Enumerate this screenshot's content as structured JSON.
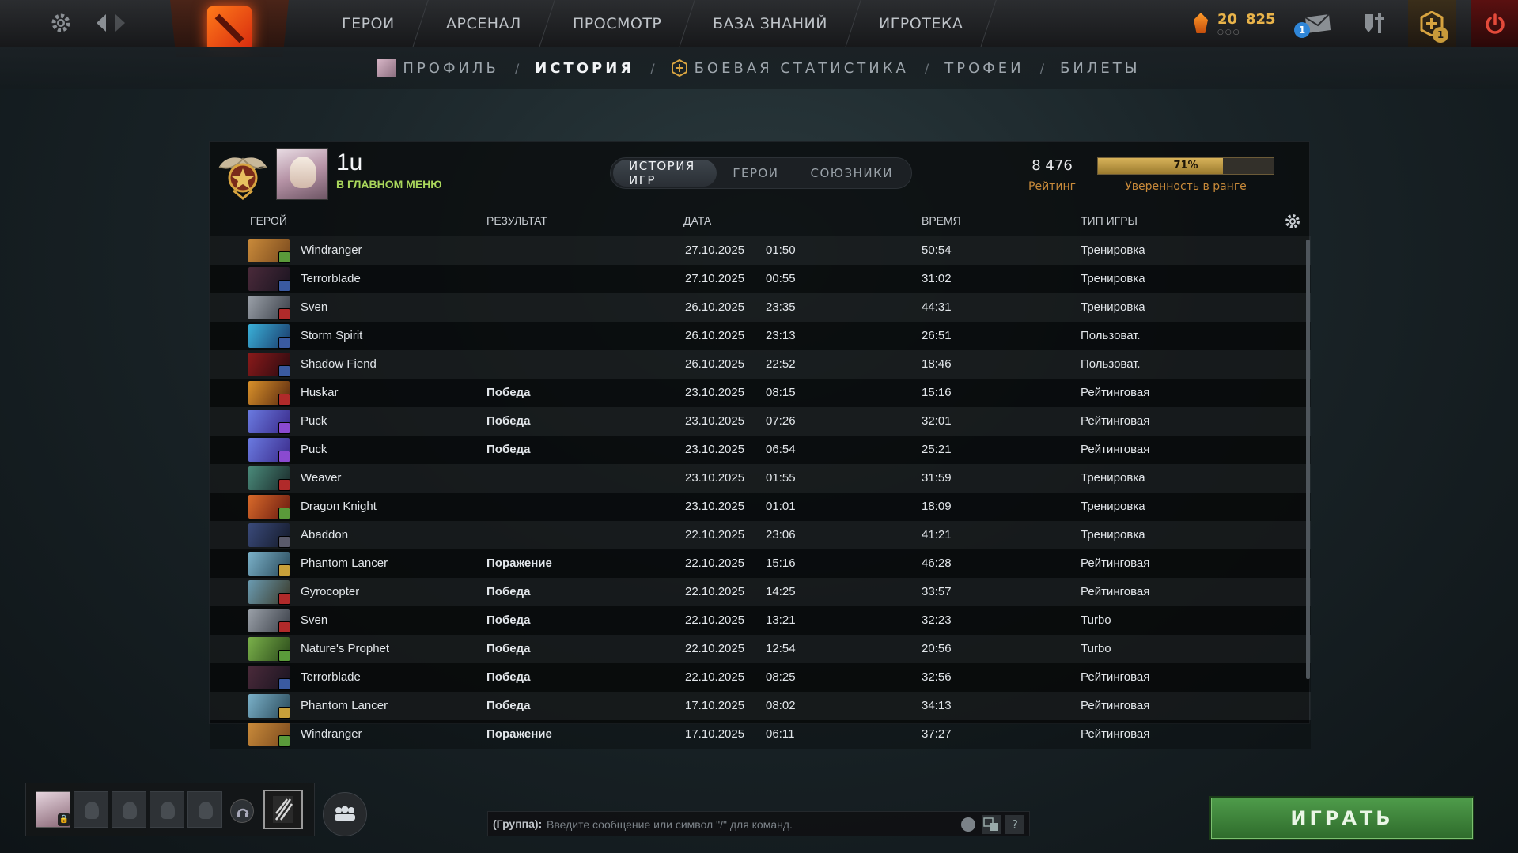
{
  "topbar": {
    "nav": [
      "ГЕРОИ",
      "АРСЕНАЛ",
      "ПРОСМОТР",
      "БАЗА ЗНАНИЙ",
      "ИГРОТЕКА"
    ],
    "currency_main": "20",
    "currency_secondary": "825",
    "mail_badge": "1",
    "shop_badge": "1"
  },
  "subnav": {
    "profile": "ПРОФИЛЬ",
    "history": "ИСТОРИЯ",
    "battle_stats": "БОЕВАЯ СТАТИСТИКА",
    "trophies": "ТРОФЕИ",
    "tickets": "БИЛЕТЫ",
    "separator": "/"
  },
  "profile": {
    "name": "1u",
    "status": "В ГЛАВНОМ МЕНЮ",
    "tabs": [
      "ИСТОРИЯ ИГР",
      "ГЕРОИ",
      "СОЮЗНИКИ"
    ],
    "rating_value": "8 476",
    "rating_label": "Рейтинг",
    "confidence_pct": "71%",
    "confidence_fraction": 0.71,
    "confidence_label": "Уверенность в ранге"
  },
  "table": {
    "headers": {
      "hero": "ГЕРОЙ",
      "result": "РЕЗУЛЬТАТ",
      "date": "ДАТА",
      "time": "ВРЕМЯ",
      "type": "ТИП ИГРЫ"
    },
    "rows": [
      {
        "hero": "Windranger",
        "result": "",
        "date": "27.10.2025",
        "clock": "01:50",
        "duration": "50:54",
        "type": "Тренировка",
        "c1": "#c98a3a",
        "c2": "#7a4a1e",
        "attr": "#5a9a3a"
      },
      {
        "hero": "Terrorblade",
        "result": "",
        "date": "27.10.2025",
        "clock": "00:55",
        "duration": "31:02",
        "type": "Тренировка",
        "c1": "#4a2a3a",
        "c2": "#1a1420",
        "attr": "#3a5aa0"
      },
      {
        "hero": "Sven",
        "result": "",
        "date": "26.10.2025",
        "clock": "23:35",
        "duration": "44:31",
        "type": "Тренировка",
        "c1": "#9aa0a8",
        "c2": "#3a3f48",
        "attr": "#b02a2a"
      },
      {
        "hero": "Storm Spirit",
        "result": "",
        "date": "26.10.2025",
        "clock": "23:13",
        "duration": "26:51",
        "type": "Пользоват.",
        "c1": "#3ab0d8",
        "c2": "#1a3a6a",
        "attr": "#3a5aa0"
      },
      {
        "hero": "Shadow Fiend",
        "result": "",
        "date": "26.10.2025",
        "clock": "22:52",
        "duration": "18:46",
        "type": "Пользоват.",
        "c1": "#8a1a1a",
        "c2": "#2a0a10",
        "attr": "#3a5aa0"
      },
      {
        "hero": "Huskar",
        "result": "Победа",
        "date": "23.10.2025",
        "clock": "08:15",
        "duration": "15:16",
        "type": "Рейтинговая",
        "c1": "#d8902a",
        "c2": "#5a2a10",
        "attr": "#b02a2a"
      },
      {
        "hero": "Puck",
        "result": "Победа",
        "date": "23.10.2025",
        "clock": "07:26",
        "duration": "32:01",
        "type": "Рейтинговая",
        "c1": "#6a7ae0",
        "c2": "#3a2a8a",
        "attr": "#8a4ad0"
      },
      {
        "hero": "Puck",
        "result": "Победа",
        "date": "23.10.2025",
        "clock": "06:54",
        "duration": "25:21",
        "type": "Рейтинговая",
        "c1": "#6a7ae0",
        "c2": "#3a2a8a",
        "attr": "#8a4ad0"
      },
      {
        "hero": "Weaver",
        "result": "",
        "date": "23.10.2025",
        "clock": "01:55",
        "duration": "31:59",
        "type": "Тренировка",
        "c1": "#4a8a7a",
        "c2": "#1a2a2a",
        "attr": "#b02a2a"
      },
      {
        "hero": "Dragon Knight",
        "result": "",
        "date": "23.10.2025",
        "clock": "01:01",
        "duration": "18:09",
        "type": "Тренировка",
        "c1": "#d86a2a",
        "c2": "#6a1a10",
        "attr": "#5a9a3a"
      },
      {
        "hero": "Abaddon",
        "result": "",
        "date": "22.10.2025",
        "clock": "23:06",
        "duration": "41:21",
        "type": "Тренировка",
        "c1": "#3a4a7a",
        "c2": "#141a2a",
        "attr": "#5a5a6a"
      },
      {
        "hero": "Phantom Lancer",
        "result": "Поражение",
        "date": "22.10.2025",
        "clock": "15:16",
        "duration": "46:28",
        "type": "Рейтинговая",
        "c1": "#7ab0c8",
        "c2": "#2a4a5a",
        "attr": "#c8a03a"
      },
      {
        "hero": "Gyrocopter",
        "result": "Победа",
        "date": "22.10.2025",
        "clock": "14:25",
        "duration": "33:57",
        "type": "Рейтинговая",
        "c1": "#6a9ab0",
        "c2": "#3a3a2a",
        "attr": "#b02a2a"
      },
      {
        "hero": "Sven",
        "result": "Победа",
        "date": "22.10.2025",
        "clock": "13:21",
        "duration": "32:23",
        "type": "Turbo",
        "c1": "#9aa0a8",
        "c2": "#3a3f48",
        "attr": "#b02a2a"
      },
      {
        "hero": "Nature's Prophet",
        "result": "Победа",
        "date": "22.10.2025",
        "clock": "12:54",
        "duration": "20:56",
        "type": "Turbo",
        "c1": "#7ab04a",
        "c2": "#2a4a1a",
        "attr": "#5a9a3a"
      },
      {
        "hero": "Terrorblade",
        "result": "Победа",
        "date": "22.10.2025",
        "clock": "08:25",
        "duration": "32:56",
        "type": "Рейтинговая",
        "c1": "#4a2a3a",
        "c2": "#1a1420",
        "attr": "#3a5aa0"
      },
      {
        "hero": "Phantom Lancer",
        "result": "Победа",
        "date": "17.10.2025",
        "clock": "08:02",
        "duration": "34:13",
        "type": "Рейтинговая",
        "c1": "#7ab0c8",
        "c2": "#2a4a5a",
        "attr": "#c8a03a"
      },
      {
        "hero": "Windranger",
        "result": "Поражение",
        "date": "17.10.2025",
        "clock": "06:11",
        "duration": "37:27",
        "type": "Рейтинговая",
        "c1": "#c98a3a",
        "c2": "#7a4a1e",
        "attr": "#5a9a3a"
      }
    ]
  },
  "chat": {
    "group_label": "(Группа):",
    "placeholder": "Введите сообщение или символ \"/\" для команд.",
    "help": "?"
  },
  "play_button": "ИГРАТЬ",
  "colors": {
    "win": "#7fcf3a",
    "loss": "#e23a2a",
    "accent": "#c88a3a",
    "play": "#3e8a3a"
  }
}
